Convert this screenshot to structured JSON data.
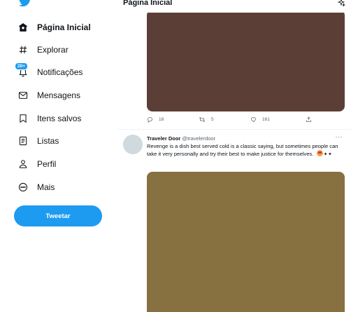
{
  "sidebar": {
    "items": [
      {
        "label": "Página Inicial",
        "icon": "home-icon",
        "active": true
      },
      {
        "label": "Explorar",
        "icon": "hashtag-icon"
      },
      {
        "label": "Notificações",
        "icon": "bell-icon",
        "badge": "20+"
      },
      {
        "label": "Mensagens",
        "icon": "envelope-icon"
      },
      {
        "label": "Itens salvos",
        "icon": "bookmark-icon"
      },
      {
        "label": "Listas",
        "icon": "list-icon"
      },
      {
        "label": "Perfil",
        "icon": "person-icon"
      },
      {
        "label": "Mais",
        "icon": "more-circle-icon"
      }
    ],
    "tweet_button": "Tweetar"
  },
  "header": {
    "title": "Página Inicial"
  },
  "feed": {
    "first_tweet": {
      "replies": "18",
      "retweets": "5",
      "likes": "161",
      "media_color": "#5b3f36"
    },
    "second_tweet": {
      "name": "Traveler Door",
      "handle": "@travelerdoor",
      "text": "Revenge is a dish best served cold is a classic saying, but sometimes people can take it very personally and try their best to make justice for themselves.",
      "more": "···",
      "media_color": "#877140"
    }
  },
  "colors": {
    "accent": "#1d9bf0",
    "text": "#0f1419",
    "muted": "#536471"
  }
}
